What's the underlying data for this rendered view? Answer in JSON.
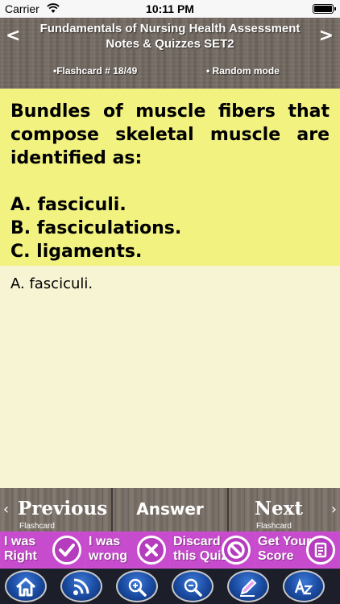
{
  "status_bar": {
    "carrier": "Carrier",
    "time": "10:11 PM"
  },
  "header": {
    "title": "Fundamentals of Nursing Health Assessment Notes & Quizzes SET2",
    "counter": "•Flashcard #  18/49",
    "mode": "• Random mode",
    "prev_arrow": "<",
    "next_arrow": ">"
  },
  "question": {
    "stem": "Bundles of muscle fibers that compose skeletal muscle are identified as:",
    "options": [
      "A. fasciculi.",
      "B. fasciculations.",
      "C. ligaments."
    ]
  },
  "answer": {
    "text": "A. fasciculi."
  },
  "navigation": {
    "previous_label": "Previous",
    "previous_sub": "Flashcard",
    "answer_label": "Answer",
    "next_label": "Next",
    "next_sub": "Flashcard",
    "left_arrow": "‹",
    "right_arrow": "›"
  },
  "rating": {
    "right_line1": "I was",
    "right_line2": "Right",
    "wrong_line1": "I was",
    "wrong_line2": "wrong",
    "discard_line1": "Discard",
    "discard_line2": "this Quiz",
    "score_line1": "Get Your",
    "score_line2": "Score"
  },
  "toolbar": {
    "icons": [
      "home-icon",
      "rss-icon",
      "zoom-in-icon",
      "zoom-out-icon",
      "edit-pencil-icon",
      "font-size-icon"
    ]
  },
  "colors": {
    "question_bg": "#f2f280",
    "answer_bg": "#f6f4d2",
    "rating_bg": "#c94fcf",
    "toolbar_bg": "#1c1f2a"
  }
}
